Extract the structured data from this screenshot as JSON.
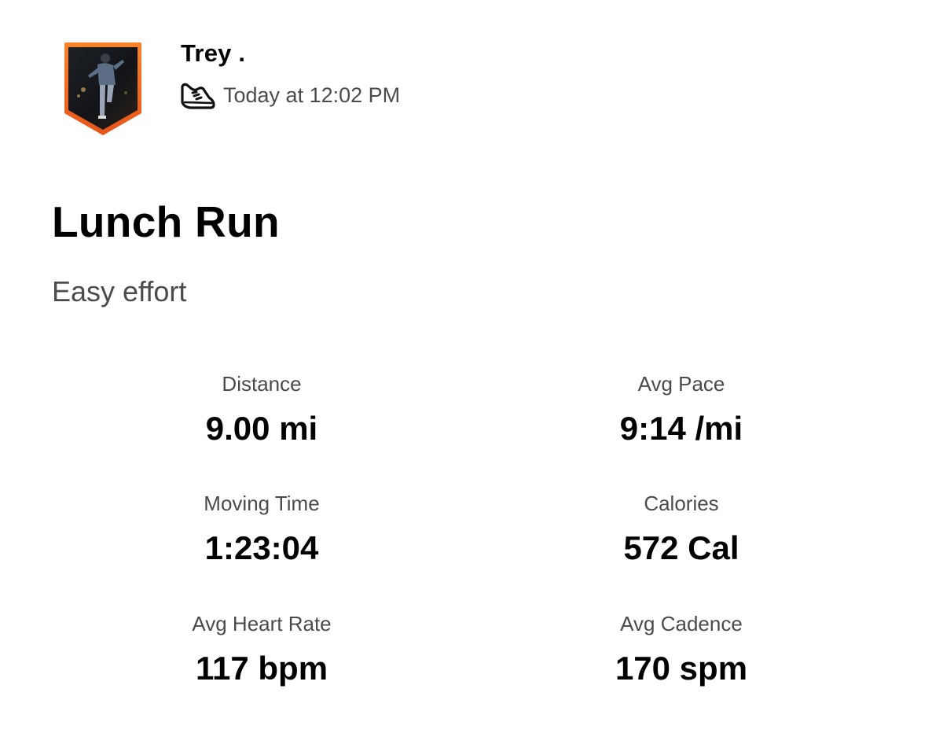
{
  "athlete": {
    "name": "Trey .",
    "avatar": "athlete-photo-badge",
    "badge_color": "#f26b1d"
  },
  "activity": {
    "sport_icon": "running-shoe-icon",
    "timestamp": "Today at 12:02 PM",
    "title": "Lunch Run",
    "description": "Easy effort"
  },
  "stats": {
    "distance": {
      "label": "Distance",
      "value": "9.00 mi"
    },
    "avg_pace": {
      "label": "Avg Pace",
      "value": "9:14 /mi"
    },
    "moving_time": {
      "label": "Moving Time",
      "value": "1:23:04"
    },
    "calories": {
      "label": "Calories",
      "value": "572 Cal"
    },
    "avg_heart_rate": {
      "label": "Avg Heart Rate",
      "value": "117 bpm"
    },
    "avg_cadence": {
      "label": "Avg Cadence",
      "value": "170 spm"
    }
  }
}
